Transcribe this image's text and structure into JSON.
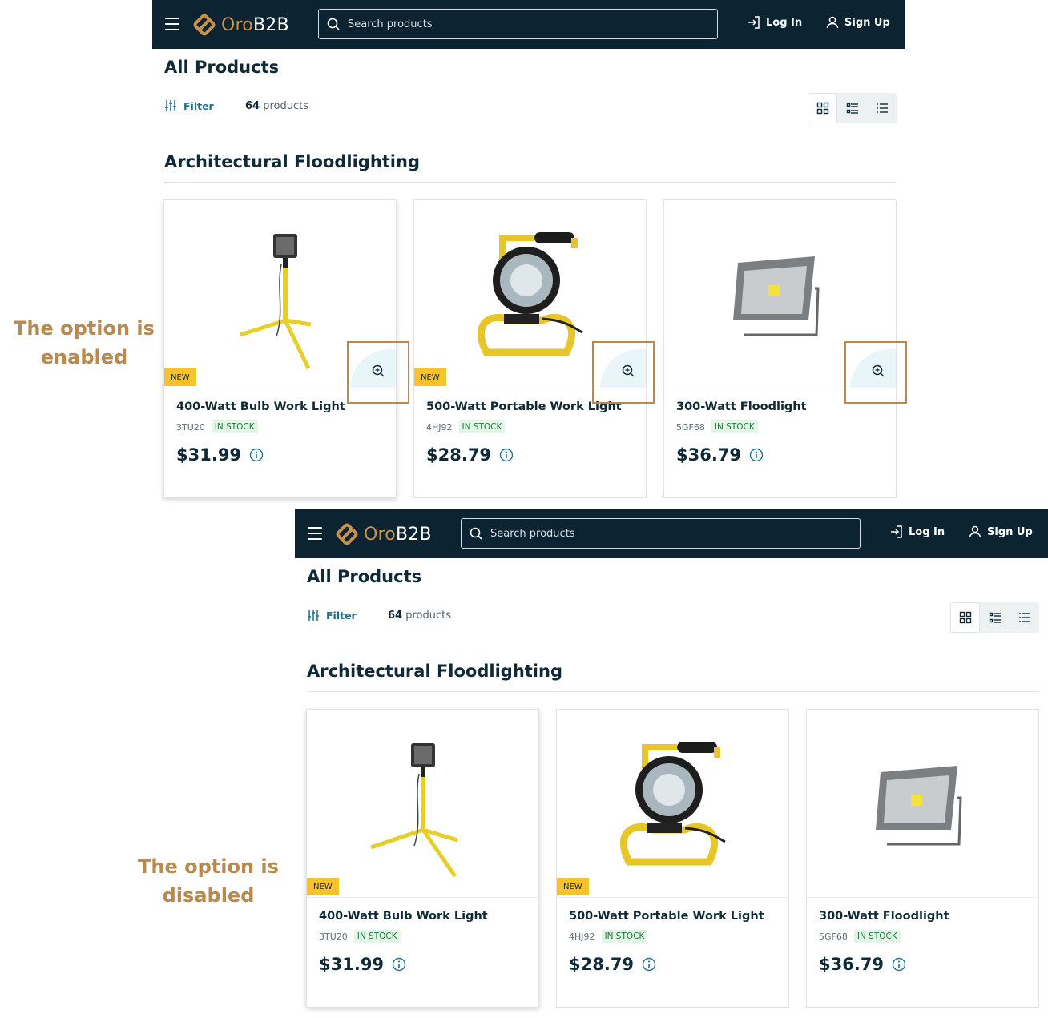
{
  "annotations": {
    "enabled_line1": "The option is",
    "enabled_line2": "enabled",
    "disabled_line1": "The option is",
    "disabled_line2": "disabled"
  },
  "header": {
    "logo_oro": "Oro",
    "logo_b2b": "B2B",
    "search_placeholder": "Search products",
    "login_label": "Log In",
    "signup_label": "Sign Up"
  },
  "page": {
    "title": "All Products",
    "filter_label": "Filter",
    "count_number": "64",
    "count_suffix": "products",
    "view_modes": [
      "grid-view-icon",
      "list-view-icon",
      "compact-list-icon"
    ],
    "active_view": "grid"
  },
  "category": {
    "title": "Architectural Floodlighting"
  },
  "products": [
    {
      "name": "400-Watt Bulb Work Light",
      "sku": "3TU20",
      "stock": "IN STOCK",
      "price": "$31.99",
      "badge": "NEW"
    },
    {
      "name": "500-Watt Portable Work Light",
      "sku": "4HJ92",
      "stock": "IN STOCK",
      "price": "$28.79",
      "badge": "NEW"
    },
    {
      "name": "300-Watt Floodlight",
      "sku": "5GF68",
      "stock": "IN STOCK",
      "price": "$36.79",
      "badge": ""
    }
  ],
  "colors": {
    "header_bg": "#0c2431",
    "brand_gold": "#c8924a",
    "annotation": "#b88a4d",
    "badge_new": "#f6c32c",
    "stock_bg": "#e3f6e8",
    "stock_text": "#1c7a3c",
    "accent": "#1f6f8b"
  }
}
